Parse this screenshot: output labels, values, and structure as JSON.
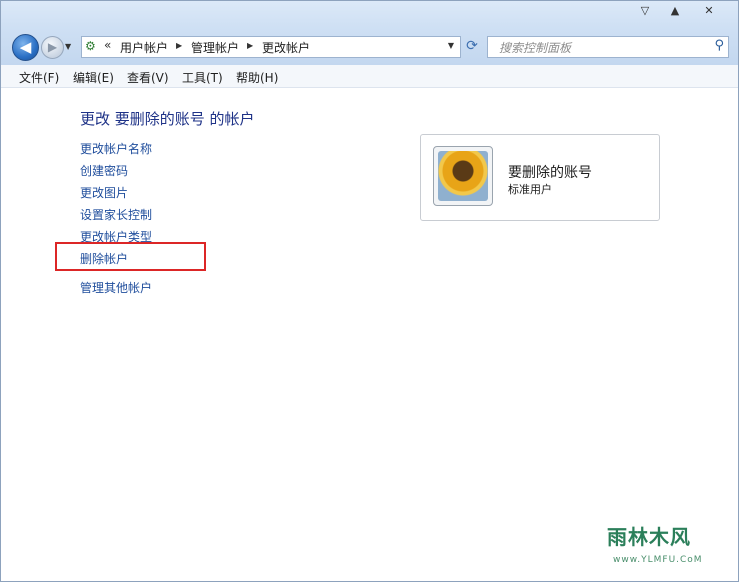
{
  "window": {
    "caption_buttons": {
      "dropdown": "▽",
      "minimize": "▲",
      "close": "✕"
    }
  },
  "nav": {
    "breadcrumb": [
      "用户帐户",
      "管理帐户",
      "更改帐户"
    ],
    "search_placeholder": "搜索控制面板"
  },
  "menu": [
    "文件(F)",
    "编辑(E)",
    "查看(V)",
    "工具(T)",
    "帮助(H)"
  ],
  "main": {
    "heading": "更改 要删除的账号 的帐户",
    "tasks": [
      "更改帐户名称",
      "创建密码",
      "更改图片",
      "设置家长控制",
      "更改帐户类型",
      "删除帐户"
    ],
    "other_link": "管理其他帐户",
    "highlight_color": "#dc2626"
  },
  "account": {
    "name": "要删除的账号",
    "role": "标准用户"
  },
  "watermark": {
    "text": "雨林木风",
    "url": "www.YLMFU.CoM"
  },
  "icons": {
    "back": "back-arrow-icon",
    "forward": "forward-arrow-icon",
    "control_panel": "control-panel-icon",
    "refresh": "refresh-icon",
    "search": "search-icon",
    "avatar": "sunflower-avatar-icon"
  },
  "colors": {
    "link": "#1f4d9c",
    "heading": "#1e3287",
    "titlebar": "#cfe0f4"
  }
}
